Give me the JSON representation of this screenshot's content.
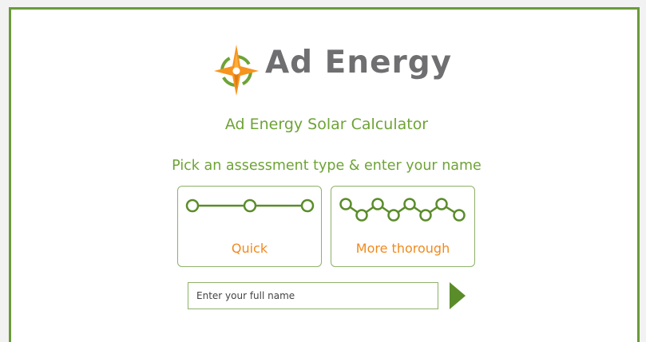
{
  "brand": {
    "name": "Ad Energy",
    "accent_color": "#6ea336",
    "secondary_color": "#f08a1e",
    "logo_icon": "compass-star-icon"
  },
  "header": {
    "title": "Ad Energy Solar Calculator",
    "subtitle": "Pick an assessment type & enter your name"
  },
  "assessment_options": [
    {
      "label": "Quick",
      "icon": "three-node-line-icon"
    },
    {
      "label": "More thorough",
      "icon": "zigzag-node-line-icon"
    }
  ],
  "name_form": {
    "placeholder": "Enter your full name",
    "value": "",
    "submit_icon": "play-arrow-icon"
  }
}
